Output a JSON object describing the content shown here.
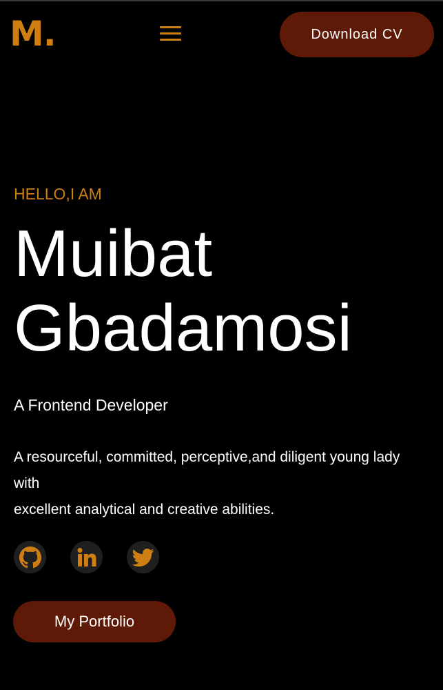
{
  "header": {
    "logo": "M.",
    "menu_icon": "hamburger-menu-icon",
    "download_cv_label": "Download CV"
  },
  "hero": {
    "greeting": "HELLO,I AM",
    "first_name": "Muibat",
    "last_name": "Gbadamosi",
    "role": "A Frontend Developer",
    "bio_line_1": "A resourceful, committed, perceptive,and diligent young lady with",
    "bio_line_2": "excellent analytical and creative abilities."
  },
  "socials": {
    "items": [
      {
        "icon": "github-icon"
      },
      {
        "icon": "linkedin-icon"
      },
      {
        "icon": "twitter-icon"
      }
    ]
  },
  "cta": {
    "portfolio_label": "My Portfolio"
  },
  "colors": {
    "background": "#000000",
    "accent": "#cf7f12",
    "button": "#5e1a07",
    "text": "#ffffff",
    "icon_bg": "#1f1f1f"
  }
}
